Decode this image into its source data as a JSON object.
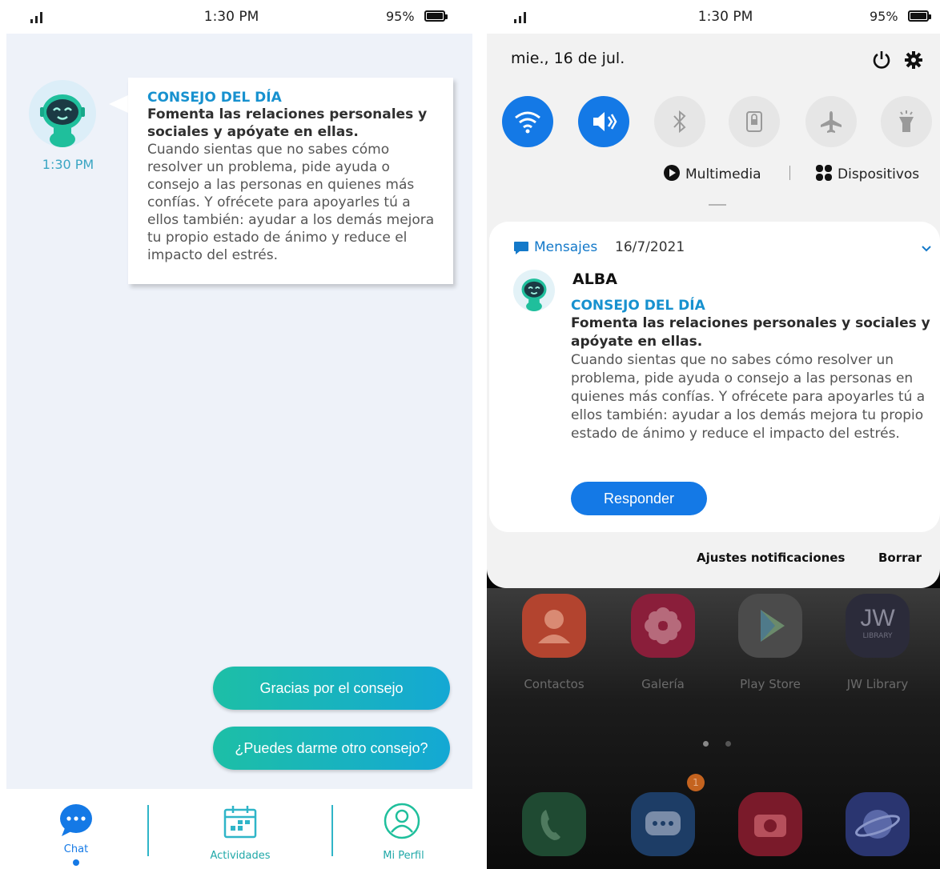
{
  "left_phone": {
    "status": {
      "time": "1:30 PM",
      "battery": "95%"
    },
    "chat": {
      "time": "1:30 PM",
      "message": {
        "heading": "CONSEJO DEL DÍA",
        "title": "Fomenta las relaciones personales y sociales y apóyate en ellas.",
        "body": "Cuando sientas que no sabes cómo resolver un problema, pide ayuda o consejo a las personas en quienes más confías. Y ofrécete para apoyarles tú a ellos también: ayudar a los demás mejora tu propio estado de ánimo y reduce el impacto del estrés."
      },
      "quick_replies": [
        "Gracias por el consejo",
        "¿Puedes darme otro consejo?"
      ]
    },
    "nav": {
      "chat": "Chat",
      "actividades": "Actividades",
      "perfil": "Mi Perfil"
    },
    "colors": {
      "accent": "#1791cf",
      "teal": "#1dbfa6",
      "chat_bg": "#eef2f9"
    }
  },
  "right_phone": {
    "status": {
      "time": "1:30 PM",
      "battery": "95%"
    },
    "quick_settings": {
      "date": "mie., 16 de jul.",
      "multimedia": "Multimedia",
      "dispositivos": "Dispositivos"
    },
    "notification": {
      "app": "Mensajes",
      "date": "16/7/2021",
      "sender": "ALBA",
      "heading": "CONSEJO DEL DÍA",
      "title": "Fomenta las relaciones personales y sociales y apóyate en ellas.",
      "body": "Cuando sientas que no sabes cómo resolver un problema, pide ayuda o consejo a las personas en quienes más confías. Y ofrécete para apoyarles tú a ellos también: ayudar a los demás mejora tu propio estado de ánimo y reduce el impacto del estrés.",
      "reply": "Responder"
    },
    "footer": {
      "settings": "Ajustes notificaciones",
      "clear": "Borrar"
    },
    "home_apps": [
      {
        "label": "Contactos"
      },
      {
        "label": "Galería"
      },
      {
        "label": "Play Store"
      },
      {
        "label": "JW Library",
        "icon_text": "JW",
        "icon_subtext": "LIBRARY"
      }
    ],
    "dock_badge": "1",
    "colors": {
      "accent": "#1479e6"
    }
  }
}
